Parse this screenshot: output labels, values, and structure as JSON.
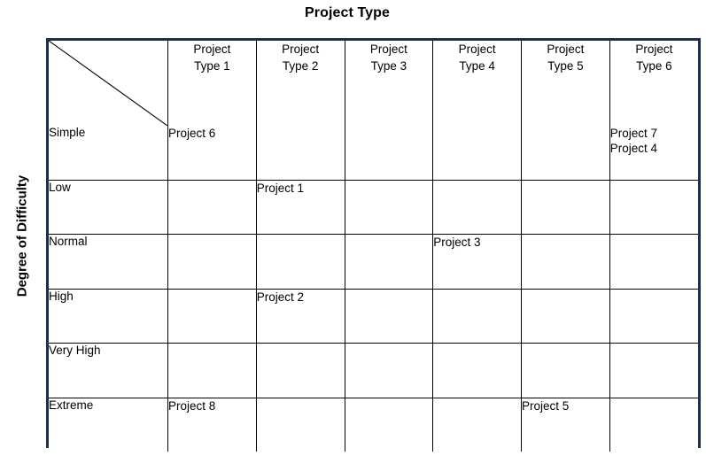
{
  "axes": {
    "column_title": "Project Type",
    "row_title": "Degree of Difficulty"
  },
  "colors": {
    "outer_border": "#1f3048",
    "grid_line": "#000000",
    "background": "#ffffff",
    "text": "#000000"
  },
  "chart_data": {
    "type": "table",
    "title": "Project Type",
    "xlabel": "Project Type",
    "ylabel": "Degree of Difficulty",
    "grid": true,
    "legend": "none",
    "categories": [
      "Project Type 1",
      "Project Type 2",
      "Project Type 3",
      "Project Type 4",
      "Project Type 5",
      "Project Type 6"
    ],
    "rows": [
      "Simple",
      "Low",
      "Normal",
      "High",
      "Very High",
      "Extreme"
    ],
    "cells": [
      [
        [
          "Project 6"
        ],
        [],
        [],
        [],
        [],
        [
          "Project 7",
          "Project 4"
        ]
      ],
      [
        [],
        [
          "Project 1"
        ],
        [],
        [],
        [],
        []
      ],
      [
        [],
        [],
        [],
        [
          "Project 3"
        ],
        [],
        []
      ],
      [
        [],
        [
          "Project 2"
        ],
        [],
        [],
        [],
        []
      ],
      [
        [],
        [],
        [],
        [],
        [],
        []
      ],
      [
        [
          "Project 8"
        ],
        [],
        [],
        [],
        [
          "Project 5"
        ],
        []
      ]
    ]
  },
  "header": {
    "columns": [
      {
        "line1": "Project",
        "line2": "Type 1"
      },
      {
        "line1": "Project",
        "line2": "Type 2"
      },
      {
        "line1": "Project",
        "line2": "Type 3"
      },
      {
        "line1": "Project",
        "line2": "Type 4"
      },
      {
        "line1": "Project",
        "line2": "Type 5"
      },
      {
        "line1": "Project",
        "line2": "Type 6"
      }
    ]
  }
}
